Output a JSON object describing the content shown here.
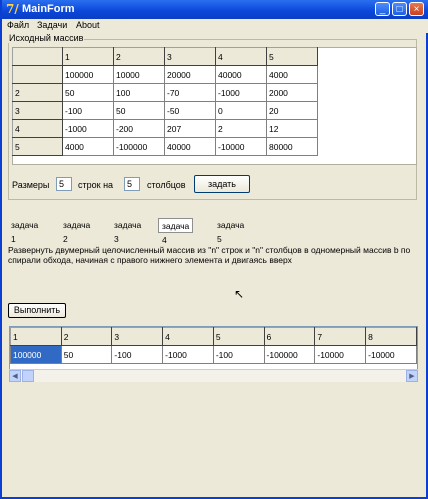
{
  "window": {
    "title": "MainForm",
    "icon_text": "7/",
    "buttons": [
      "minimize-icon",
      "maximize-icon",
      "close-icon"
    ]
  },
  "menu": [
    "Файл",
    "Задачи",
    "About"
  ],
  "group": {
    "label": "Исходный массив",
    "col_headers": [
      "",
      "1",
      "2",
      "3",
      "4",
      "5"
    ],
    "rows": [
      [
        "",
        "100000",
        "10000",
        "20000",
        "40000",
        "4000"
      ],
      [
        "2",
        "50",
        "100",
        "-70",
        "-1000",
        "2000"
      ],
      [
        "3",
        "-100",
        "50",
        "-50",
        "0",
        "20"
      ],
      [
        "4",
        "-1000",
        "-200",
        "207",
        "2",
        "12"
      ],
      [
        "5",
        "4000",
        "-100000",
        "40000",
        "-10000",
        "80000"
      ]
    ]
  },
  "size_row": {
    "label_size": "Размеры",
    "rows_value": "5",
    "label_rows": "строк на",
    "cols_value": "5",
    "label_cols": "столбцов",
    "set_button": "задать"
  },
  "tabs": [
    "задача 1",
    "задача 2",
    "задача 3",
    "задача 4",
    "задача 5"
  ],
  "active_tab": 3,
  "description": "Развернуть двумерный целочисленный массив из \"n\" строк и \"n\" столбцов в одномерный массив b по спирали обхода, начиная с правого нижнего элемента и двигаясь вверх",
  "run_button": "Выполнить",
  "result": {
    "headers": [
      "1",
      "2",
      "3",
      "4",
      "5",
      "6",
      "7",
      "8"
    ],
    "values": [
      "100000",
      "50",
      "-100",
      "-1000",
      "-100",
      "-100000",
      "-10000",
      "-10000"
    ]
  }
}
